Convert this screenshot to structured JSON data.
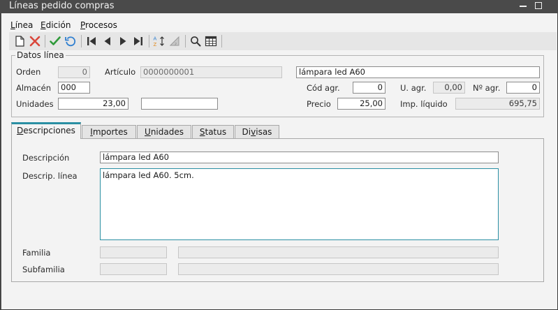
{
  "window": {
    "title": "Líneas pedido compras"
  },
  "menu": {
    "items": [
      {
        "mnemonic": "L",
        "rest": "ínea"
      },
      {
        "mnemonic": "E",
        "rest": "dición"
      },
      {
        "mnemonic": "P",
        "rest": "rocesos"
      }
    ]
  },
  "toolbar": {
    "icons": [
      "new-document-icon",
      "delete-icon",
      "accept-icon",
      "refresh-icon",
      "first-record-icon",
      "previous-record-icon",
      "next-record-icon",
      "last-record-icon",
      "sort-ascending-icon",
      "sort-descending-icon",
      "search-icon",
      "grid-view-icon"
    ]
  },
  "datos_linea": {
    "title": "Datos línea",
    "orden": {
      "label": "Orden",
      "value": "0"
    },
    "articulo": {
      "label": "Artículo",
      "value": "0000000001",
      "name": "lámpara led A60"
    },
    "almacen": {
      "label": "Almacén",
      "value": "000"
    },
    "unidades": {
      "label": "Unidades",
      "value": "23,00",
      "extra": ""
    },
    "cod_agr": {
      "label": "Cód agr.",
      "value": "0"
    },
    "u_agr": {
      "label": "U. agr.",
      "value": "0,00"
    },
    "n_agr": {
      "label": "Nº agr.",
      "value": "0"
    },
    "precio": {
      "label": "Precio",
      "value": "25,00"
    },
    "imp_liquido": {
      "label": "Imp. líquido",
      "value": "695,75"
    }
  },
  "tabs": [
    {
      "before": "",
      "mnemonic": "D",
      "after": "escripciones"
    },
    {
      "before": "",
      "mnemonic": "I",
      "after": "mportes"
    },
    {
      "before": "",
      "mnemonic": "U",
      "after": "nidades"
    },
    {
      "before": "",
      "mnemonic": "S",
      "after": "tatus"
    },
    {
      "before": "Di",
      "mnemonic": "v",
      "after": "isas"
    }
  ],
  "descripciones": {
    "descripcion": {
      "label": "Descripción",
      "value": "lámpara led A60"
    },
    "descrip_linea": {
      "label": "Descrip. línea",
      "value": "lámpara led A60. 5cm."
    },
    "familia": {
      "label": "Familia",
      "code": "",
      "name": ""
    },
    "subfamilia": {
      "label": "Subfamilia",
      "code": "",
      "name": ""
    }
  },
  "colors": {
    "accent": "#2a8fa3",
    "delete": "#d9463a",
    "accept": "#2f9a3a",
    "refresh": "#2f7fd0"
  }
}
